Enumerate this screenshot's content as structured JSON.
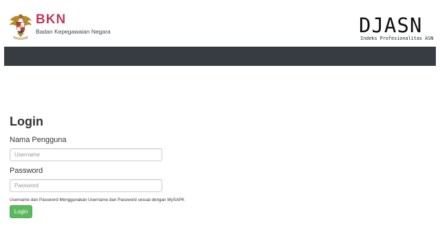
{
  "header": {
    "brand_name": "BKN",
    "brand_subtitle": "Badan Kepegawaian Negara",
    "app_name": "DJASN",
    "app_subtitle": "Indeks Profesionalitas ASN"
  },
  "login": {
    "title": "Login",
    "username_label": "Nama Pengguna",
    "username_placeholder": "Username",
    "username_value": "",
    "password_label": "Password",
    "password_placeholder": "Password",
    "password_value": "",
    "hint": "Username dan Password Menggunakan Username dan Password sesuai dengan MySAPK",
    "submit_label": "Login"
  },
  "colors": {
    "brand": "#c0395a",
    "navbar": "#373b42",
    "button": "#5cb85c"
  },
  "icons": {
    "logo": "garuda-emblem-icon"
  }
}
